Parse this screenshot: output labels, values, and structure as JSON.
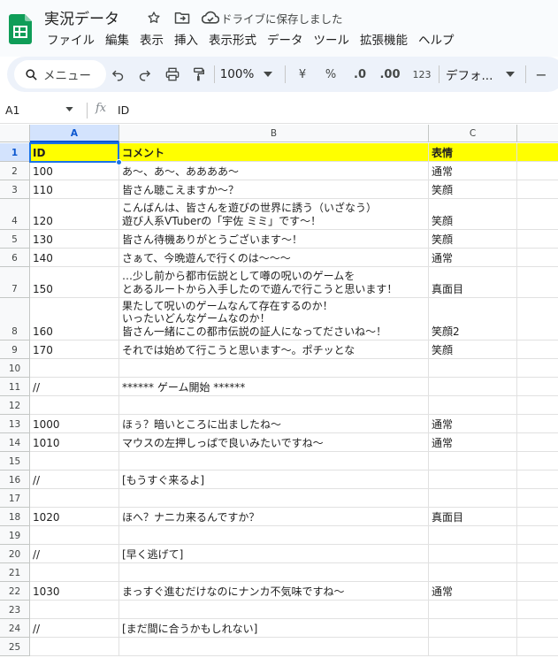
{
  "app": {
    "title": "実況データ",
    "save_status": "ドライブに保存しました"
  },
  "menu": [
    "ファイル",
    "編集",
    "表示",
    "挿入",
    "表示形式",
    "データ",
    "ツール",
    "拡張機能",
    "ヘルプ"
  ],
  "toolbar": {
    "search_label": "メニュー",
    "zoom": "100%",
    "currency": "¥",
    "percent": "%",
    "dec_decrease": ".0",
    "dec_increase": ".00",
    "number_format": "123",
    "font": "デフォ...",
    "font_size_minus": "−"
  },
  "formula_bar": {
    "name_box": "A1",
    "fx": "fx",
    "value": "ID"
  },
  "sheet": {
    "columns": [
      "A",
      "B",
      "C"
    ],
    "rows": [
      {
        "n": "1",
        "a": "ID",
        "b": "コメント",
        "c": "表情"
      },
      {
        "n": "2",
        "a": "100",
        "b": "あ～、あ～、ああああ～",
        "c": "通常"
      },
      {
        "n": "3",
        "a": "110",
        "b": "皆さん聴こえますか～？",
        "c": "笑顔"
      },
      {
        "n": "4",
        "a": "120",
        "b": "こんばんは、皆さんを遊びの世界に誘う（いざなう）\n遊び人系VTuberの「宇佐 ミミ」です～！",
        "c": "笑顔"
      },
      {
        "n": "5",
        "a": "130",
        "b": "皆さん待機ありがとうございます～！",
        "c": "笑顔"
      },
      {
        "n": "6",
        "a": "140",
        "b": "さぁて、今晩遊んで行くのは～～～",
        "c": "通常"
      },
      {
        "n": "7",
        "a": "150",
        "b": "…少し前から都市伝説として噂の呪いのゲームを\nとあるルートから入手したので遊んで行こうと思います！",
        "c": "真面目"
      },
      {
        "n": "8",
        "a": "160",
        "b": "果たして呪いのゲームなんて存在するのか！\nいったいどんなゲームなのか！\n皆さん一緒にこの都市伝説の証人になってださいね～！",
        "c": "笑顔2"
      },
      {
        "n": "9",
        "a": "170",
        "b": "それでは始めて行こうと思います～。ポチッとな",
        "c": "笑顔"
      },
      {
        "n": "10",
        "a": "",
        "b": "",
        "c": ""
      },
      {
        "n": "11",
        "a": "//",
        "b": "****** ゲーム開始 ******",
        "c": ""
      },
      {
        "n": "12",
        "a": "",
        "b": "",
        "c": ""
      },
      {
        "n": "13",
        "a": "1000",
        "b": "ほぅ？暗いところに出ましたね～",
        "c": "通常"
      },
      {
        "n": "14",
        "a": "1010",
        "b": "マウスの左押しっぱで良いみたいですね～",
        "c": "通常"
      },
      {
        "n": "15",
        "a": "",
        "b": "",
        "c": ""
      },
      {
        "n": "16",
        "a": "//",
        "b": "[もうすぐ来るよ]",
        "c": ""
      },
      {
        "n": "17",
        "a": "",
        "b": "",
        "c": ""
      },
      {
        "n": "18",
        "a": "1020",
        "b": "ほへ？ナニカ来るんですか？",
        "c": "真面目"
      },
      {
        "n": "19",
        "a": "",
        "b": "",
        "c": ""
      },
      {
        "n": "20",
        "a": "//",
        "b": "[早く逃げて]",
        "c": ""
      },
      {
        "n": "21",
        "a": "",
        "b": "",
        "c": ""
      },
      {
        "n": "22",
        "a": "1030",
        "b": "まっすぐ進むだけなのにナンカ不気味ですね～",
        "c": "通常"
      },
      {
        "n": "23",
        "a": "",
        "b": "",
        "c": ""
      },
      {
        "n": "24",
        "a": "//",
        "b": "[まだ間に合うかもしれない]",
        "c": ""
      },
      {
        "n": "25",
        "a": "",
        "b": "",
        "c": ""
      }
    ]
  },
  "colors": {
    "header_highlight": "#ffff00",
    "selection": "#1a73e8",
    "app_green": "#0f9d58"
  },
  "icons": [
    "sheets-logo-icon",
    "star-icon",
    "move-folder-icon",
    "cloud-saved-icon",
    "search-icon",
    "undo-icon",
    "redo-icon",
    "print-icon",
    "paint-format-icon",
    "dropdown-caret-icon"
  ]
}
